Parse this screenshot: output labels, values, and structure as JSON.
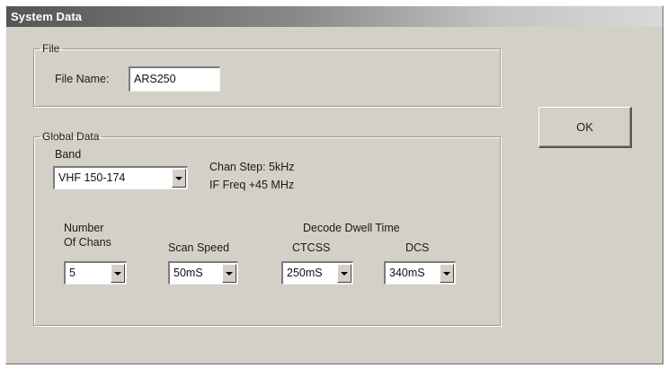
{
  "window": {
    "title": "System Data"
  },
  "file_group": {
    "legend": "File",
    "file_name_label": "File Name:",
    "file_name_value": "ARS250"
  },
  "global_group": {
    "legend": "Global Data",
    "band_label": "Band",
    "band_value": "VHF 150-174",
    "chan_step": "Chan Step: 5kHz",
    "if_freq": "IF Freq +45 MHz",
    "number_label_line1": "Number",
    "number_label_line2": "Of Chans",
    "number_value": "5",
    "scan_speed_label": "Scan Speed",
    "scan_speed_value": "50mS",
    "decode_dwell_label": "Decode Dwell Time",
    "ctcss_label": "CTCSS",
    "ctcss_value": "250mS",
    "dcs_label": "DCS",
    "dcs_value": "340mS"
  },
  "buttons": {
    "ok_label": "OK"
  },
  "icons": {
    "dropdown_arrow": "chevron-down-icon"
  }
}
